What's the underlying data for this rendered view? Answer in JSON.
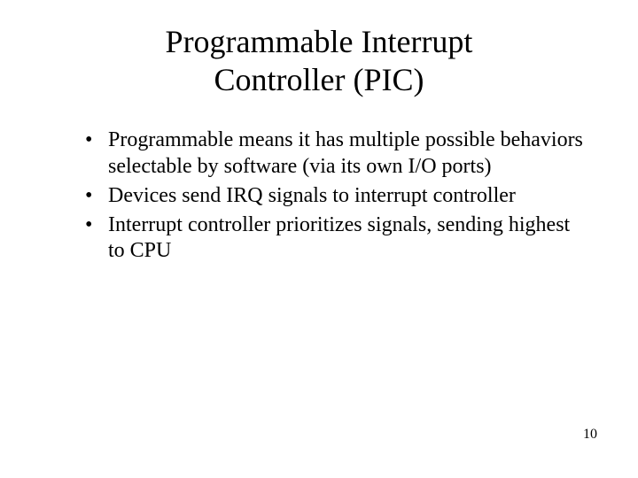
{
  "title_line1": "Programmable Interrupt",
  "title_line2": "Controller (PIC)",
  "bullets": [
    "Programmable means it has multiple possible behaviors selectable by software (via its own I/O ports)",
    "Devices send IRQ signals to interrupt controller",
    "Interrupt controller prioritizes signals, sending highest to CPU"
  ],
  "page_number": "10",
  "bullet_glyph": "•"
}
